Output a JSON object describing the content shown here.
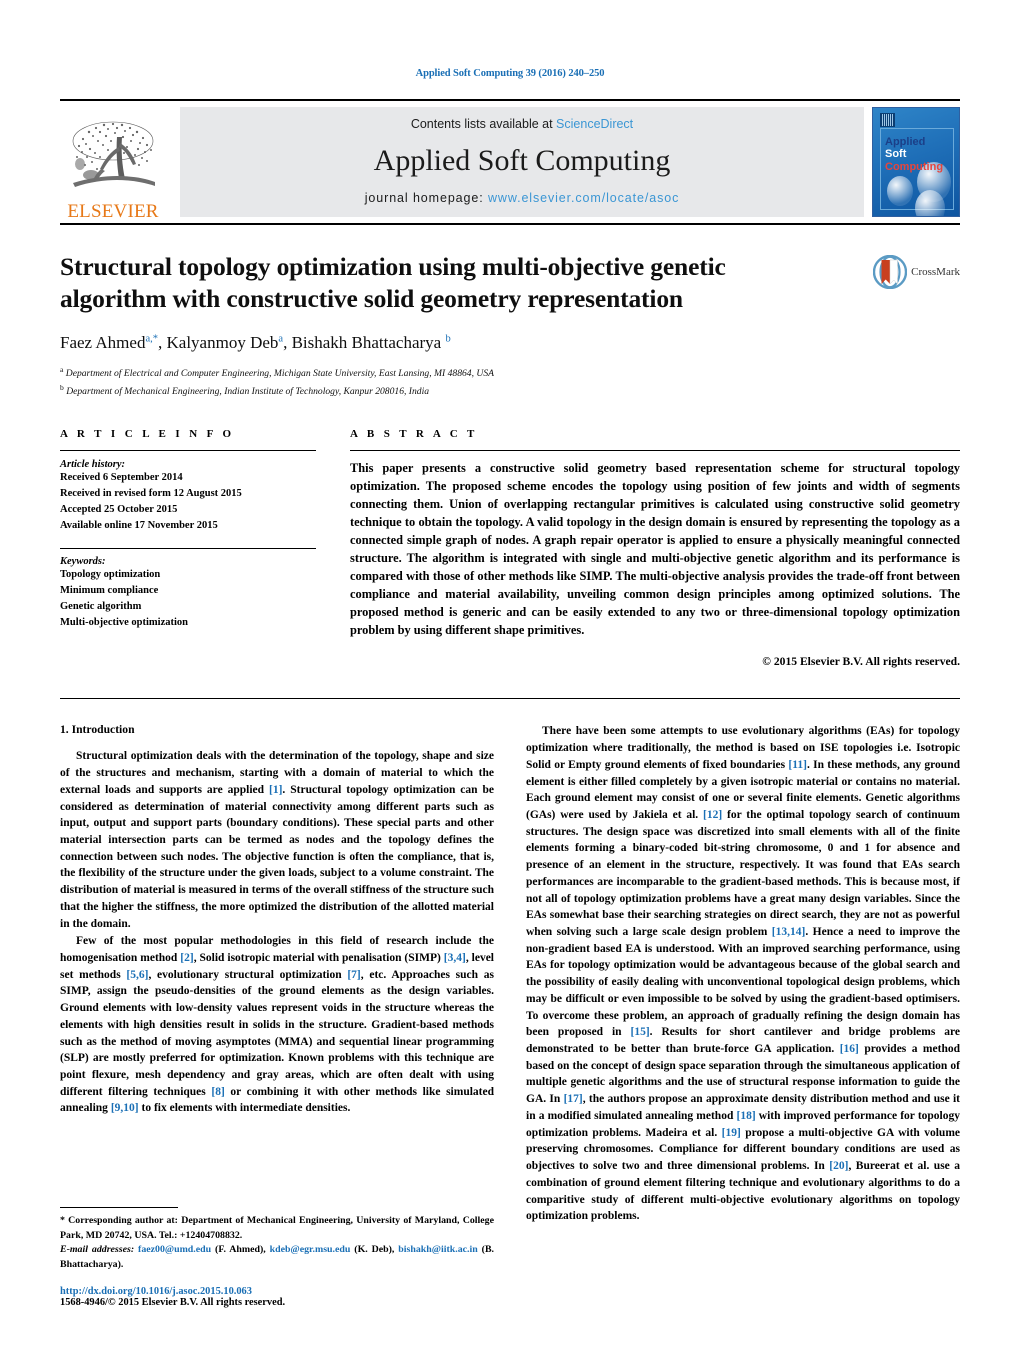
{
  "running_head": "Applied Soft Computing 39 (2016) 240–250",
  "masthead": {
    "publisher_logo_text": "ELSEVIER",
    "contents_prefix": "Contents lists available at ",
    "contents_link": "ScienceDirect",
    "journal_name": "Applied Soft Computing",
    "homepage_prefix": "journal homepage: ",
    "homepage_url": "www.elsevier.com/locate/asoc",
    "cover": {
      "line1": "Applied",
      "line2": "Soft",
      "line3": "Computing"
    },
    "colors": {
      "link_blue": "#3b96d4",
      "elsevier_orange": "#e77817",
      "band_gray": "#e7e8ea",
      "cover_blue": "#1f6fb8",
      "cover_red": "#e8453c"
    }
  },
  "title_block": {
    "title": "Structural topology optimization using multi-objective genetic algorithm with constructive solid geometry representation",
    "authors_html": "Faez Ahmed<sup>a,*</sup>, Kalyanmoy Deb<sup>a</sup>, Bishakh Bhattacharya <sup>b</sup>",
    "affiliation_a": "Department of Electrical and Computer Engineering, Michigan State University, East Lansing, MI 48864, USA",
    "affiliation_b": "Department of Mechanical Engineering, Indian Institute of Technology, Kanpur 208016, India",
    "crossmark_label": "CrossMark"
  },
  "article_info": {
    "heading": "A R T I C L E    I N F O",
    "history_title": "Article history:",
    "history": [
      "Received 6 September 2014",
      "Received in revised form 12 August 2015",
      "Accepted 25 October 2015",
      "Available online 17 November 2015"
    ],
    "keywords_title": "Keywords:",
    "keywords": [
      "Topology optimization",
      "Minimum compliance",
      "Genetic algorithm",
      "Multi-objective optimization"
    ]
  },
  "abstract": {
    "heading": "A B S T R A C T",
    "text": "This paper presents a constructive solid geometry based representation scheme for structural topology optimization. The proposed scheme encodes the topology using position of few joints and width of segments connecting them. Union of overlapping rectangular primitives is calculated using constructive solid geometry technique to obtain the topology. A valid topology in the design domain is ensured by representing the topology as a connected simple graph of nodes. A graph repair operator is applied to ensure a physically meaningful connected structure. The algorithm is integrated with single and multi-objective genetic algorithm and its performance is compared with those of other methods like SIMP. The multi-objective analysis provides the trade-off front between compliance and material availability, unveiling common design principles among optimized solutions. The proposed method is generic and can be easily extended to any two or three-dimensional topology optimization problem by using different shape primitives.",
    "copyright": "© 2015 Elsevier B.V. All rights reserved."
  },
  "body": {
    "section_heading": "1.  Introduction",
    "left_paragraphs": [
      "Structural optimization deals with the determination of the topology, shape and size of the structures and mechanism, starting with a domain of material to which the external loads and supports are applied [1]. Structural topology optimization can be considered as determination of material connectivity among different parts such as input, output and support parts (boundary conditions). These special parts and other material intersection parts can be termed as nodes and the topology defines the connection between such nodes. The objective function is often the compliance, that is, the flexibility of the structure under the given loads, subject to a volume constraint. The distribution of material is measured in terms of the overall stiffness of the structure such that the higher the stiffness, the more optimized the distribution of the allotted material in the domain.",
      "Few of the most popular methodologies in this field of research include the homogenisation method [2], Solid isotropic material with penalisation (SIMP) [3,4], level set methods [5,6], evolutionary structural optimization [7], etc. Approaches such as SIMP, assign the pseudo-densities of the ground elements as the design variables. Ground elements with low-density values represent voids in the structure whereas the elements with high densities result in solids in the structure. Gradient-based methods such as the method of moving asymptotes (MMA) and sequential linear programming (SLP) are mostly preferred for optimization. Known problems with this technique are point flexure, mesh dependency and gray areas, which are often dealt with using different filtering techniques [8] or combining it with other methods like simulated annealing [9,10] to fix elements with intermediate densities."
    ],
    "right_paragraphs": [
      "There have been some attempts to use evolutionary algorithms (EAs) for topology optimization where traditionally, the method is based on ISE topologies i.e. Isotropic Solid or Empty ground elements of fixed boundaries [11]. In these methods, any ground element is either filled completely by a given isotropic material or contains no material. Each ground element may consist of one or several finite elements. Genetic algorithms (GAs) were used by Jakiela et al. [12] for the optimal topology search of continuum structures. The design space was discretized into small elements with all of the finite elements forming a binary-coded bit-string chromosome, 0 and 1 for absence and presence of an element in the structure, respectively. It was found that EAs search performances are incomparable to the gradient-based methods. This is because most, if not all of topology optimization problems have a great many design variables. Since the EAs somewhat base their searching strategies on direct search, they are not as powerful when solving such a large scale design problem [13,14]. Hence a need to improve the non-gradient based EA is understood. With an improved searching performance, using EAs for topology optimization would be advantageous because of the global search and the possibility of easily dealing with unconventional topological design problems, which may be difficult or even impossible to be solved by using the gradient-based optimisers. To overcome these problem, an approach of gradually refining the design domain has been proposed in [15]. Results for short cantilever and bridge problems are demonstrated to be better than brute-force GA application. [16] provides a method based on the concept of design space separation through the simultaneous application of multiple genetic algorithms and the use of structural response information to guide the GA. In [17], the authors propose an approximate density distribution method and use it in a modified simulated annealing method [18] with improved performance for topology optimization problems. Madeira et al. [19] propose a multi-objective GA with volume preserving chromosomes. Compliance for different boundary conditions are used as objectives to solve two and three dimensional problems. In [20], Bureerat et al. use a combination of ground element filtering technique and evolutionary algorithms to do a comparitive study of different multi-objective evolutionary algorithms on topology optimization problems."
    ]
  },
  "footnote": {
    "corresponding": "* Corresponding author at: Department of Mechanical Engineering, University of Maryland, College Park, MD 20742, USA. Tel.: +12404708832.",
    "email_label": "E-mail addresses:",
    "emails": [
      {
        "address": "faez00@umd.edu",
        "person": "(F. Ahmed)"
      },
      {
        "address": "kdeb@egr.msu.edu",
        "person": "(K. Deb)"
      },
      {
        "address": "bishakh@iitk.ac.in",
        "person": "(B. Bhattacharya)."
      }
    ],
    "doi": "http://dx.doi.org/10.1016/j.asoc.2015.10.063",
    "issn": "1568-4946/© 2015 Elsevier B.V. All rights reserved."
  }
}
